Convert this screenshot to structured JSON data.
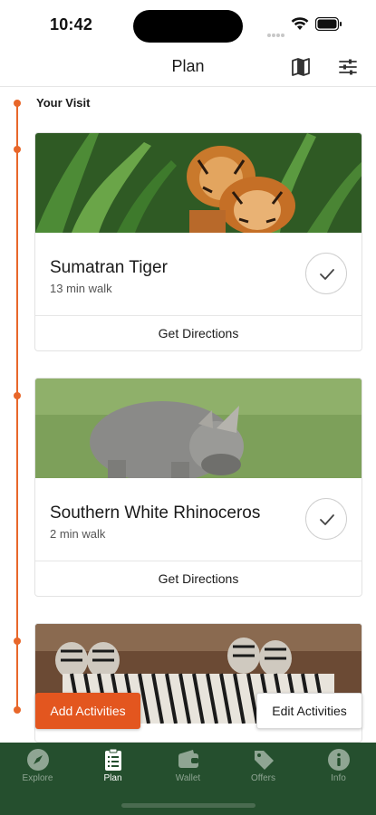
{
  "status_bar": {
    "time": "10:42"
  },
  "nav": {
    "title": "Plan",
    "map_icon": "map-icon",
    "filter_icon": "sliders-icon"
  },
  "section": {
    "title": "Your Visit"
  },
  "cards": [
    {
      "title": "Sumatran Tiger",
      "walk": "13 min walk",
      "action": "Get Directions",
      "image": "tigers-photo"
    },
    {
      "title": "Southern White Rhinoceros",
      "walk": "2 min walk",
      "action": "Get Directions",
      "image": "rhinoceros-photo"
    },
    {
      "image": "zebras-photo"
    }
  ],
  "buttons": {
    "add": "Add Activities",
    "edit": "Edit Activities"
  },
  "tabs": [
    {
      "label": "Explore",
      "icon": "compass-icon",
      "active": false
    },
    {
      "label": "Plan",
      "icon": "clipboard-icon",
      "active": true
    },
    {
      "label": "Wallet",
      "icon": "wallet-icon",
      "active": false
    },
    {
      "label": "Offers",
      "icon": "tag-icon",
      "active": false
    },
    {
      "label": "Info",
      "icon": "info-icon",
      "active": false
    }
  ],
  "colors": {
    "accent": "#e3561f",
    "timeline": "#e8672a",
    "tab_bar": "#254f2e"
  }
}
